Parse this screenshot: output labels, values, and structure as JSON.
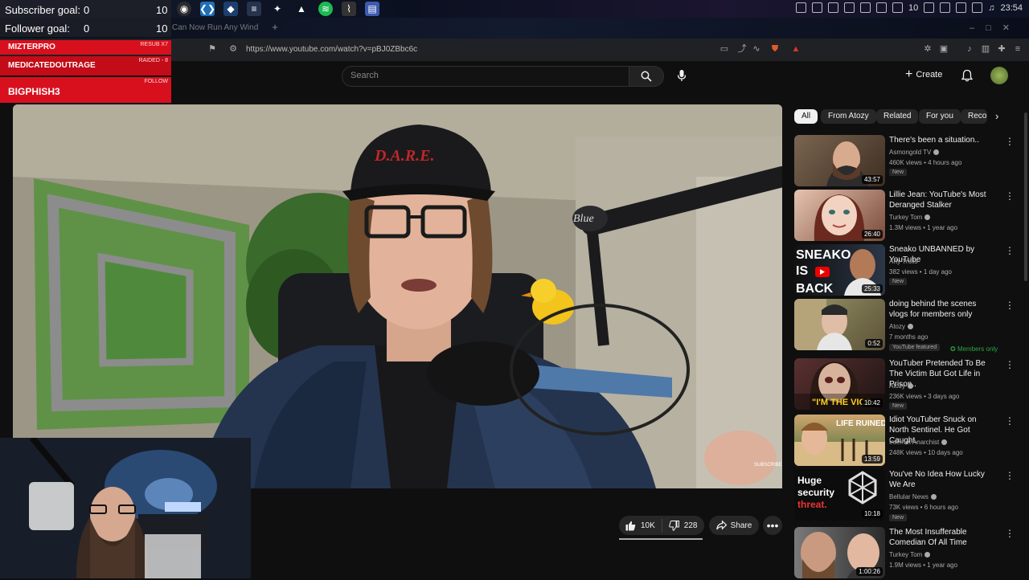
{
  "stream_overlay": {
    "goals": [
      {
        "label": "Subscriber goal:",
        "value": "0",
        "max": "10"
      },
      {
        "label": "Follower goal:",
        "value": "0",
        "max": "10"
      }
    ],
    "alerts": [
      {
        "name": "MIZTERPRO",
        "tag": "RESUB X7"
      },
      {
        "name": "MEDICATEDOUTRAGE",
        "tag": "RAIDED - 8"
      },
      {
        "name": "BIGPHISH3",
        "tag": "FOLLOW"
      }
    ]
  },
  "os": {
    "tray_count": "10",
    "clock": "23:54",
    "taskbar_icons": [
      "obs-icon",
      "vscode-icon",
      "steam-icon",
      "devtools-icon",
      "browser-icon",
      "upload-icon",
      "spotify-icon",
      "monitor-icon",
      "notes-icon"
    ]
  },
  "browser": {
    "tab_title": "Can Now Run Any Wind",
    "url": "https://www.youtube.com/watch?v=pBJ0ZBbc6c"
  },
  "youtube": {
    "search_placeholder": "Search",
    "create_label": "Create",
    "player_watermark": "SUBSCRIBE",
    "cap_text": "D.A.R.E."
  },
  "actions": {
    "likes": "10K",
    "dislikes": "228",
    "share": "Share"
  },
  "chips": [
    "All",
    "From Atozy",
    "Related",
    "For you",
    "Reco"
  ],
  "recommendations": [
    {
      "title": "There's been a situation..",
      "channel": "Asmongold TV",
      "verified": true,
      "meta": "460K views • 4 hours ago",
      "badge": "New",
      "duration": "43:57",
      "thumb": [
        "#6b5a48",
        "#3d2e22"
      ]
    },
    {
      "title": "Lillie Jean: YouTube's Most Deranged Stalker",
      "channel": "Turkey Tom",
      "verified": true,
      "meta": "1.3M views • 1 year ago",
      "badge": "",
      "duration": "26:40",
      "thumb": [
        "#d7b4a0",
        "#6a4236"
      ]
    },
    {
      "title": "Sneako UNBANNED by YouTube",
      "channel": "Arty Trolls",
      "verified": false,
      "meta": "382 views • 1 day ago",
      "badge": "New",
      "duration": "25:33",
      "thumb": [
        "#1a1a1a",
        "#2e3a4a"
      ],
      "overlay": [
        "SNEAKO",
        "IS",
        "BACK"
      ]
    },
    {
      "title": "doing behind the scenes vlogs for members only",
      "channel": "Atozy",
      "verified": true,
      "meta": "7 months ago",
      "badge": "YouTube featured",
      "members": "Members only",
      "duration": "0:52",
      "thumb": [
        "#8a8560",
        "#5a5236"
      ]
    },
    {
      "title": "YouTuber Pretended To Be The Victim But Got Life in Prison..",
      "channel": "Atozy",
      "verified": true,
      "meta": "236K views • 3 days ago",
      "badge": "New",
      "duration": "10:42",
      "thumb": [
        "#4e2c2c",
        "#1e1414"
      ],
      "overlay": [
        "\"I'M THE VICT"
      ]
    },
    {
      "title": "Idiot YouTuber Snuck on North Sentinel. He Got Caught.",
      "channel": "Internet Anarchist",
      "verified": true,
      "meta": "248K views • 10 days ago",
      "badge": "",
      "duration": "13:59",
      "thumb": [
        "#c9a070",
        "#3e6d3a"
      ],
      "overlay": [
        "LIFE RUINED"
      ]
    },
    {
      "title": "You've No Idea How Lucky We Are",
      "channel": "Bellular News",
      "verified": true,
      "meta": "73K views • 6 hours ago",
      "badge": "New",
      "duration": "10:18",
      "thumb": [
        "#0c0c0c",
        "#1a1a1a"
      ],
      "overlay": [
        "Huge",
        "security",
        "threat."
      ]
    },
    {
      "title": "The Most Insufferable Comedian Of All Time",
      "channel": "Turkey Tom",
      "verified": true,
      "meta": "1.9M views • 1 year ago",
      "badge": "",
      "duration": "1:00:26",
      "thumb": [
        "#6a6a6a",
        "#2a2a2a"
      ]
    }
  ]
}
